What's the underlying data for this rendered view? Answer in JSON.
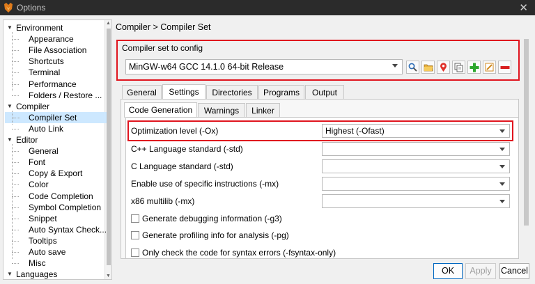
{
  "window": {
    "title": "Options",
    "close_glyph": "✕"
  },
  "tree": {
    "items": [
      {
        "label": "Environment",
        "level": 0,
        "expanded": true
      },
      {
        "label": "Appearance",
        "level": 1
      },
      {
        "label": "File Association",
        "level": 1
      },
      {
        "label": "Shortcuts",
        "level": 1
      },
      {
        "label": "Terminal",
        "level": 1
      },
      {
        "label": "Performance",
        "level": 1
      },
      {
        "label": "Folders / Restore ...",
        "level": 1
      },
      {
        "label": "Compiler",
        "level": 0,
        "expanded": true
      },
      {
        "label": "Compiler Set",
        "level": 1,
        "selected": true
      },
      {
        "label": "Auto Link",
        "level": 1
      },
      {
        "label": "Editor",
        "level": 0,
        "expanded": true
      },
      {
        "label": "General",
        "level": 1
      },
      {
        "label": "Font",
        "level": 1
      },
      {
        "label": "Copy & Export",
        "level": 1
      },
      {
        "label": "Color",
        "level": 1
      },
      {
        "label": "Code Completion",
        "level": 1
      },
      {
        "label": "Symbol Completion",
        "level": 1
      },
      {
        "label": "Snippet",
        "level": 1
      },
      {
        "label": "Auto Syntax Check...",
        "level": 1
      },
      {
        "label": "Tooltips",
        "level": 1
      },
      {
        "label": "Auto save",
        "level": 1
      },
      {
        "label": "Misc",
        "level": 1
      },
      {
        "label": "Languages",
        "level": 0,
        "expanded": true
      }
    ]
  },
  "breadcrumb": "Compiler > Compiler Set",
  "compiler_set": {
    "legend": "Compiler set to config",
    "selected": "MinGW-w64 GCC 14.1.0 64-bit Release",
    "toolbar_icons": [
      "search-icon",
      "folder-icon",
      "locate-icon",
      "copy-icon",
      "add-icon",
      "rename-icon",
      "remove-icon"
    ]
  },
  "outer_tabs": [
    {
      "label": "General"
    },
    {
      "label": "Settings",
      "active": true
    },
    {
      "label": "Directories"
    },
    {
      "label": "Programs"
    },
    {
      "label": "Output"
    }
  ],
  "inner_tabs": [
    {
      "label": "Code Generation",
      "active": true
    },
    {
      "label": "Warnings"
    },
    {
      "label": "Linker"
    }
  ],
  "options": [
    {
      "label": "Optimization level (-Ox)",
      "value": "Highest (-Ofast)"
    },
    {
      "label": "C++ Language standard (-std)",
      "value": ""
    },
    {
      "label": "C Language standard (-std)",
      "value": ""
    },
    {
      "label": "Enable use of specific instructions (-mx)",
      "value": ""
    },
    {
      "label": "x86 multilib (-mx)",
      "value": ""
    }
  ],
  "checkboxes": [
    {
      "label": "Generate debugging information (-g3)",
      "checked": false
    },
    {
      "label": "Generate profiling info for analysis (-pg)",
      "checked": false
    },
    {
      "label": "Only check the code for syntax errors (-fsyntax-only)",
      "checked": false
    }
  ],
  "buttons": {
    "ok": "OK",
    "apply": "Apply",
    "cancel": "Cancel"
  },
  "colors": {
    "highlight_red": "#e0141e",
    "selection": "#cde8ff",
    "add_green": "#2ea82e",
    "remove_red": "#d81e1e"
  }
}
